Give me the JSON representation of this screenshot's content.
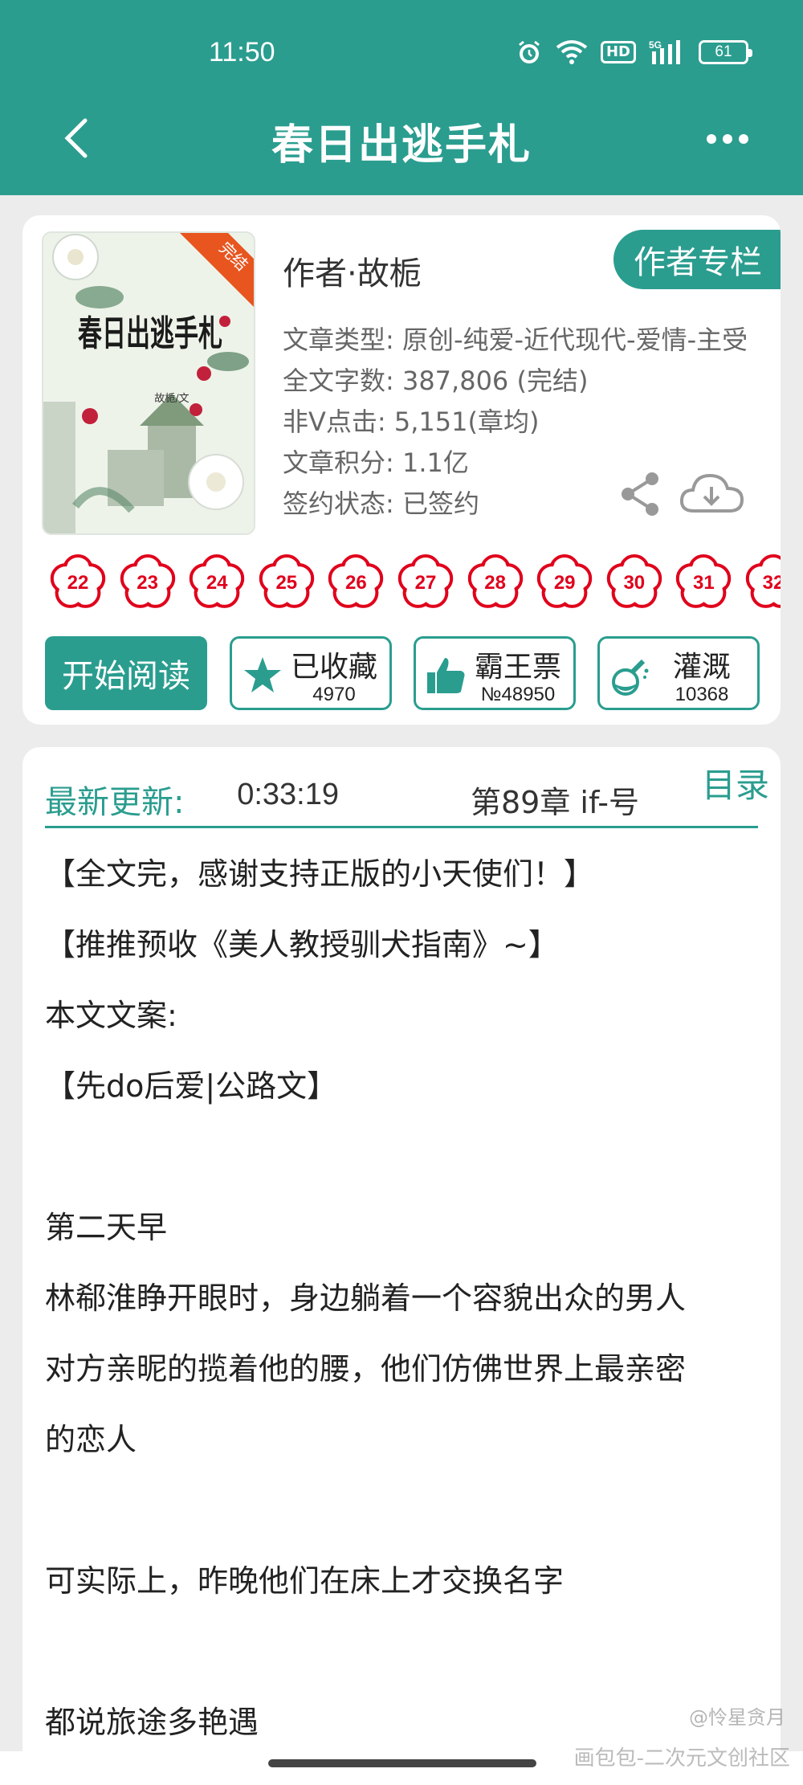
{
  "status": {
    "time": "11:50",
    "battery": "61",
    "network": "5G",
    "hd": "HD"
  },
  "nav": {
    "title": "春日出逃手札"
  },
  "book": {
    "author": "作者·故栀",
    "author_column_label": "作者专栏",
    "cover_badge": "完结",
    "cover_title": "春日出逃手札",
    "cover_byline": "故栀/文",
    "meta": {
      "type": "文章类型: 原创-纯爱-近代现代-爱情-主受",
      "words": "全文字数: 387,806 (完结)",
      "clicks": "非Ⅴ点击: 5,151(章均)",
      "score": "文章积分: 1.1亿",
      "contract": "签约状态:  已签约"
    },
    "flower_numbers": [
      "22",
      "23",
      "24",
      "25",
      "26",
      "27",
      "28",
      "29",
      "30",
      "31",
      "32"
    ]
  },
  "actions": {
    "read_label": "开始阅读",
    "collect": {
      "label": "已收藏",
      "count": "4970",
      "icon": "star-icon"
    },
    "vote": {
      "label": "霸王票",
      "count": "№48950",
      "icon": "thumbs-up-icon"
    },
    "water": {
      "label": "灌溉",
      "count": "10368",
      "icon": "nutrient-flask-icon"
    }
  },
  "update": {
    "label": "最新更新:",
    "time": "0:33:19",
    "chapter": "第89章  if-号",
    "toc_label": "目录"
  },
  "synopsis": [
    "【全文完，感谢支持正版的小天使们！】",
    "【推推预收《美人教授驯犬指南》~】",
    "本文文案:",
    "【先do后爱|公路文】",
    "",
    "第二天早",
    "林郗淮睁开眼时，身边躺着一个容貌出众的男人",
    "对方亲昵的揽着他的腰，他们仿佛世界上最亲密",
    "的恋人",
    "",
    "可实际上，昨晚他们在床上才交换名字",
    "",
    "都说旅途多艳遇"
  ],
  "watermark": {
    "line1": "@怜星贪月",
    "line2": "画包包-二次元文创社区"
  },
  "colors": {
    "primary": "#2a9d8f",
    "flower": "#e0001b"
  }
}
